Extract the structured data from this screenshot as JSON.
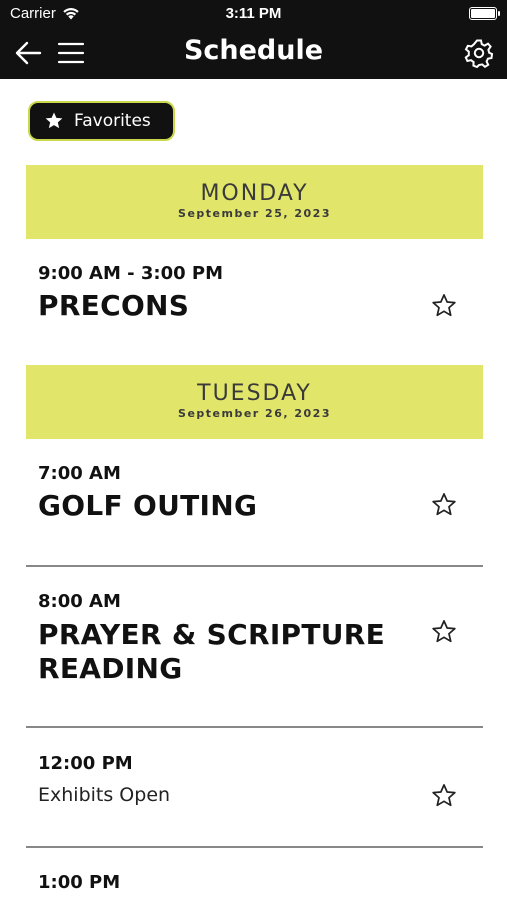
{
  "status_bar": {
    "carrier": "Carrier",
    "time": "3:11 PM"
  },
  "nav": {
    "title": "Schedule"
  },
  "favorites_button": {
    "label": "Favorites"
  },
  "days": [
    {
      "day": "MONDAY",
      "date": "September 25, 2023"
    },
    {
      "day": "TUESDAY",
      "date": "September 26, 2023"
    }
  ],
  "events": [
    {
      "time": "9:00 AM - 3:00 PM",
      "title": "PRECONS"
    },
    {
      "time": "7:00 AM",
      "title": "GOLF OUTING"
    },
    {
      "time": "8:00 AM",
      "title": "PRAYER & SCRIPTURE READING"
    },
    {
      "time": "12:00 PM",
      "title": "Exhibits Open"
    },
    {
      "time": "1:00 PM",
      "title": ""
    }
  ],
  "colors": {
    "header_bg": "#111111",
    "accent": "#e1e66b",
    "accent_border": "#c9d84a"
  },
  "icons": [
    "back-arrow-icon",
    "hamburger-menu-icon",
    "gear-icon",
    "star-icon",
    "wifi-icon",
    "battery-icon"
  ]
}
